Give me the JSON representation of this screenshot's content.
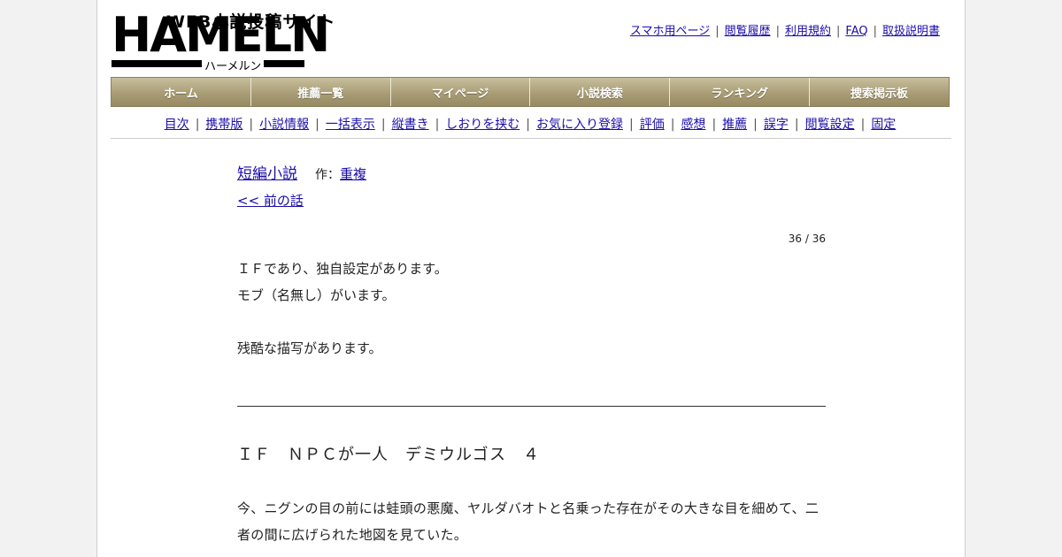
{
  "logo": {
    "tagline": "WEB小説投稿サイト",
    "wordmark": "HAMELN",
    "kana": "ハーメルン"
  },
  "top_links": [
    "スマホ用ページ",
    "閲覧履歴",
    "利用規約",
    "FAQ",
    "取扱説明書"
  ],
  "global_nav": [
    "ホーム",
    "推薦一覧",
    "マイページ",
    "小説検索",
    "ランキング",
    "捜索掲示板"
  ],
  "sub_nav": [
    "目次",
    "携帯版",
    "小説情報",
    "一括表示",
    "縦書き",
    "しおりを挟む",
    "お気に入り登録",
    "評価",
    "感想",
    "推薦",
    "誤字",
    "閲覧設定",
    "固定"
  ],
  "novel": {
    "title": "短編小説",
    "author_label": "作：",
    "author": "重複",
    "prev_link": "<< 前の話",
    "pager": "36 / 36"
  },
  "notes": [
    "ＩＦであり、独自設定があります。",
    "モブ（名無し）がいます。",
    "",
    "残酷な描写があります。"
  ],
  "chapter_title": "ＩＦ　ＮＰＣが一人　デミウルゴス　４",
  "body_text": "今、ニグンの目の前には蛙頭の悪魔、ヤルダバオトと名乗った存在がその大きな目を細めて、二者の間に広げられた地図を見ていた。"
}
